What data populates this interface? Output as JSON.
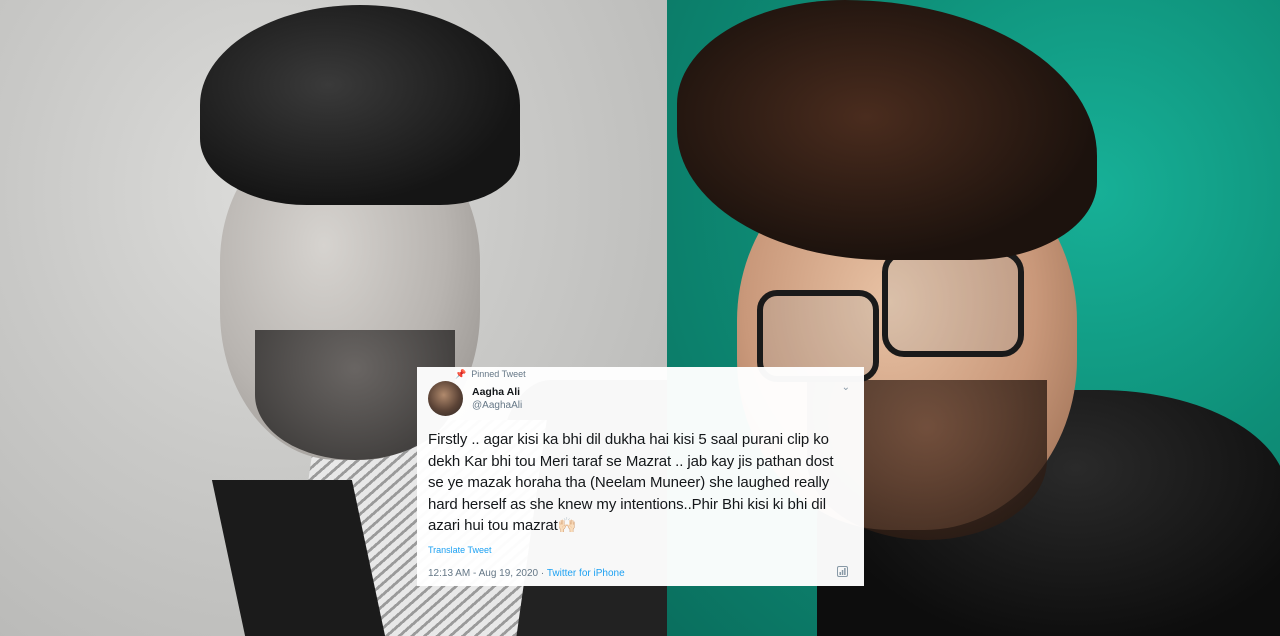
{
  "tweet": {
    "pinned_label": "Pinned Tweet",
    "author_name": "Aagha Ali",
    "author_handle": "@AaghaAli",
    "text": "Firstly .. agar kisi ka bhi dil dukha hai kisi 5 saal purani clip ko dekh Kar bhi tou Meri taraf se Mazrat .. jab kay jis pathan dost se ye mazak horaha tha (Neelam Muneer) she laughed really hard herself as she knew my intentions..Phir Bhi kisi ki bhi dil azari hui tou mazrat🙌🏻",
    "translate_label": "Translate Tweet",
    "timestamp": "12:13 AM - Aug 19, 2020",
    "separator": " · ",
    "source": "Twitter for iPhone",
    "icons": {
      "pin": "pin-icon",
      "chevron": "chevron-down-icon",
      "analytics": "analytics-icon"
    }
  },
  "colors": {
    "link": "#1da1f2",
    "secondary_text": "#657786",
    "right_background": "#12a08a"
  }
}
